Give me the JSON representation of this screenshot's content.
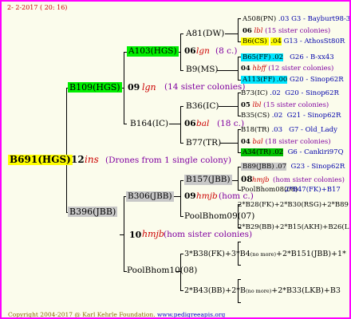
{
  "header": {
    "date": "2- 2-2017 ( 20: 16)"
  },
  "footer": {
    "copyright": "Copyright 2004-2017 @ Karl Kehrle Foundation.",
    "site": "www.pedigreeapis.org"
  },
  "colors": {
    "frame": "#ff00ff",
    "background": "#fbfcec",
    "yellow": "#ffff00",
    "green": "#00ee00",
    "cyan": "#00e5ff",
    "gray": "#c8c8c8"
  },
  "root": {
    "id": "B691(HGS)",
    "num": "12",
    "code": "ins",
    "note": "(Drones from 1 single colony)"
  },
  "gen1": {
    "top": {
      "id": "B109(HGS)",
      "num": "09",
      "code": "lgn",
      "note": "(14 sister colonies)"
    },
    "bottom": {
      "id": "B396(JBB)",
      "num": "10",
      "code": "hmjb",
      "note": "(hom sister colonies)"
    }
  },
  "gen2": {
    "a103": {
      "id": "A103(HGS)",
      "num": "06",
      "code": "lgn",
      "note": "(8 c.)"
    },
    "b164": {
      "id": "B164(IC)",
      "num": "06",
      "code": "bal",
      "note": "(18 c.)"
    },
    "b306": {
      "id": "B306(JBB)",
      "num": "09",
      "code": "hmjb",
      "note": "(hom c.)"
    },
    "poolbhom10": {
      "id": "PoolBhom10(08)"
    }
  },
  "gen3": {
    "a81": {
      "id": "A81(DW)"
    },
    "b9": {
      "id": "B9(MS)"
    },
    "b36": {
      "id": "B36(IC)"
    },
    "b77": {
      "id": "B77(TR)"
    },
    "b157": {
      "id": "B157(JBB)",
      "num": "08",
      "code": "hmjb",
      "note": "(hom sister colonies)"
    },
    "poolbhom09": {
      "id": "PoolBhom09(07)"
    },
    "b38line": {
      "text_a": "3*B38(FK)+3*B4",
      "text_b": "(no more)",
      "text_c": "+2*B151(JBB)+1*"
    },
    "b43line": {
      "text_a": "2*B43(BB)+2*B",
      "text_b": "(no more)",
      "text_c": "+2*B33(LKB)+B3"
    }
  },
  "gen4": {
    "a508": {
      "id": "A508(PN)",
      "num": ".03",
      "place": "G3 - Bayburt98-3"
    },
    "a508b": {
      "num": "06",
      "code": "lbl",
      "note": "(15 sister colonies)"
    },
    "b6": {
      "id": "B6(CS)",
      "num": ".04",
      "place": "G13 - AthosSt80R"
    },
    "b65": {
      "id": "B65(FF)",
      "num": ".02",
      "place": "G26 - B-xx43"
    },
    "b65b": {
      "num": "04",
      "code": "hbff",
      "note": "(12 sister colonies)"
    },
    "a113": {
      "id": "A113(FF)",
      "num": ".00",
      "place": "G20 - Sinop62R"
    },
    "b73": {
      "id": "B73(IC)",
      "num": ".02",
      "place": "G20 - Sinop62R"
    },
    "b73b": {
      "num": "05",
      "code": "lbl",
      "note": "(15 sister colonies)"
    },
    "b35": {
      "id": "B35(CS)",
      "num": ".02",
      "place": "G21 - Sinop62R"
    },
    "b18": {
      "id": "B18(TR)",
      "num": ".03",
      "place": "G7 - Old_Lady"
    },
    "b18b": {
      "num": "04",
      "code": "bal",
      "note": "(18 sister colonies)"
    },
    "a34": {
      "id": "A34(TR)",
      "num": ".02",
      "place": "G6 - Cankiri97Q"
    },
    "b89": {
      "id": "B89(JBB)",
      "num": ".07",
      "place": "G23 - Sinop62R"
    },
    "pool08": {
      "text": "PoolBhom08(08)",
      "over": "2*B47(FK)+B17",
      "extra": "B17"
    },
    "b28line": {
      "text": "2*B28(FK)+2*B30(RSG)+2*B89"
    },
    "b29line": {
      "text": "2*B29(BB)+2*B15(AKH)+B26(LB)"
    }
  }
}
